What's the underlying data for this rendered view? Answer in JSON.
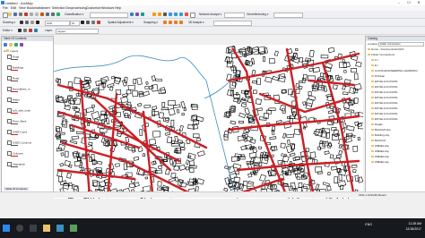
{
  "window": {
    "title": "Untitled - ArcMap",
    "controls": [
      "–",
      "☐",
      "✕"
    ]
  },
  "menu": [
    "File",
    "Edit",
    "View",
    "Bookmarks",
    "Insert",
    "Selection",
    "Geoprocessing",
    "Customize",
    "Windows",
    "Help"
  ],
  "toolbar1": {
    "classification_label": "Classification ▾",
    "network_label": "Network Analyst ▾",
    "georef_label": "Georeferencing ▾"
  },
  "toolbar2": {
    "drawing_label": "Drawing ▾",
    "layer_label": "Layer:",
    "layer_value": "Layers",
    "font_value": "Arial",
    "size_value": "10",
    "spatial_adj": "Spatial Adjustment ▾",
    "snapping": "Snapping ▾",
    "editor": "Editor ▾",
    "georef2": "3D Analyst ▾"
  },
  "toc": {
    "title": "Table Of Contents",
    "root": "Layers",
    "layers": [
      "Road",
      "Buildings",
      "Road",
      "Boundaries_ro",
      "Water",
      "soft_side_main",
      "River_Bank",
      "OSED Land",
      "OSED Columns",
      "Columns",
      "Vegetation"
    ],
    "bottom_tabs": [
      "Table Of Contents"
    ]
  },
  "catalog": {
    "title": "Catalog",
    "location_label": "Location:",
    "location_value": "Folder Connections",
    "items": [
      "Home - Documents\\ArcGIS",
      "Folder Connections",
      "C:\\",
      "E:\\",
      "ArcGIS ENGINEERING LEARNING",
      "D\\Urban",
      "ENYELLUCUVZOL",
      "ENYELLUCUVZOL",
      "ENYELLUCUVZOL",
      "ENYELLUCUVZOL",
      "ENYELLUCUVZOL",
      "ENYELLUCUVZOL",
      "ENYELLUCUVZOL",
      "ENYELLUCUVZOL",
      "Roads",
      "BACKUP.shp",
      "Building.shp",
      "BACKUP",
      "W8DEd.shp",
      "W8DEd.shp",
      "W8DEd.shp",
      "W8DEd.shp"
    ]
  },
  "status": {
    "coords": "1521.1 1034.89 Meters"
  },
  "taskbar": {
    "time": "11:28 AM",
    "date": "12/18/2017",
    "lang": "ENG"
  },
  "colors": {
    "road": "#cc1f26",
    "building": "#000000",
    "water": "#3c8fbf",
    "taskbar": "#16191d"
  }
}
